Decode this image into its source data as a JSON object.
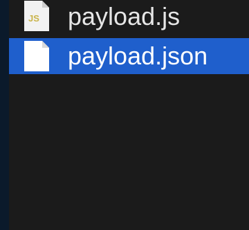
{
  "colors": {
    "background": "#1b1b1b",
    "gutter": "#0b1a2b",
    "selection": "#1f5fcc",
    "text": "#e6e6e6",
    "text_selected": "#ffffff",
    "js_badge": "#c9b44a"
  },
  "files": [
    {
      "name": "payload.js",
      "icon": "js-file-icon",
      "badge": "JS",
      "selected": false
    },
    {
      "name": "payload.json",
      "icon": "document-file-icon",
      "selected": true
    }
  ]
}
